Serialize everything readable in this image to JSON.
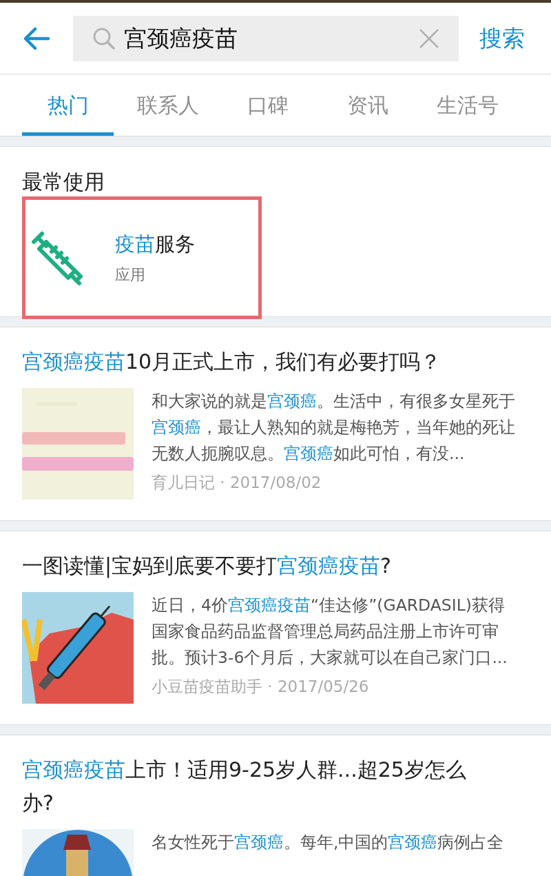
{
  "search": {
    "value": "宫颈癌疫苗",
    "button": "搜索"
  },
  "tabs": [
    {
      "label": "热门",
      "selected": true
    },
    {
      "label": "联系人",
      "selected": false
    },
    {
      "label": "口碑",
      "selected": false
    },
    {
      "label": "资讯",
      "selected": false
    },
    {
      "label": "生活号",
      "selected": false
    }
  ],
  "most_used": {
    "heading": "最常使用",
    "items": [
      {
        "title": "**疫苗**服务",
        "subtitle": "应用",
        "highlighted": true
      }
    ]
  },
  "articles": [
    {
      "title": "**宫颈癌疫苗**10月正式上市，我们有必要打吗？",
      "summary": "和大家说的就是**宫颈癌**。生活中，有很多女星死于**宫颈癌**，最让人熟知的就是梅艳芳，当年她的死让无数人扼腕叹息。**宫颈癌**如此可怕，有没...",
      "source": "育儿日记 · 2017/08/02"
    },
    {
      "title": "一图读懂|宝妈到底要不要打**宫颈癌疫苗**?",
      "summary": "近日，4价**宫颈癌疫苗**“佳达修”(GARDASIL)获得国家食品药品监督管理总局药品注册上市许可审批。预计3-6个月后，大家就可以在自己家门口...",
      "source": "小豆苗疫苗助手 · 2017/05/26"
    },
    {
      "title": "**宫颈癌疫苗**上市！适用9-25岁人群...超25岁怎么办?",
      "summary": "名女性死于**宫颈癌**。每年,中国的**宫颈癌**病例占全"
    }
  ]
}
